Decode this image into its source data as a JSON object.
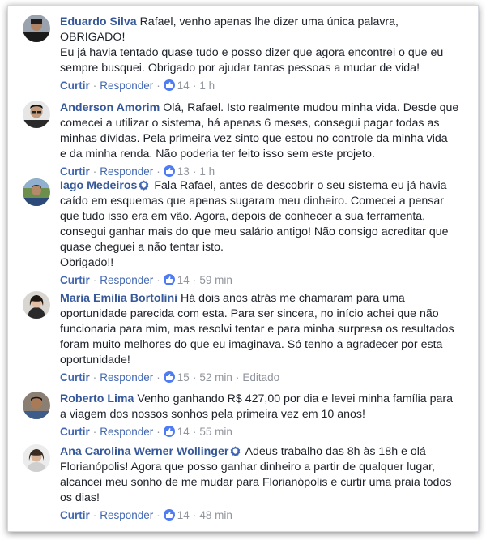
{
  "actions": {
    "curtir": "Curtir",
    "responder": "Responder",
    "dot": "·"
  },
  "colors": {
    "name": "#365899",
    "link": "#4267b2",
    "meta": "#90949c",
    "like": "#4f7cf3"
  },
  "comments": [
    {
      "name": "Eduardo Silva",
      "verified": false,
      "lines": [
        "Rafael, venho apenas lhe dizer uma única palavra,",
        "OBRIGADO!",
        "Eu já havia tentado quase tudo e posso dizer que agora encontrei o que eu",
        "sempre busquei. Obrigado por ajudar tantas pessoas a mudar de vida!"
      ],
      "likes": "14",
      "time": "1 h",
      "edited": ""
    },
    {
      "name": "Anderson Amorim",
      "verified": false,
      "lines": [
        "Olá, Rafael. Isto realmente mudou minha vida. Desde que",
        "comecei a utilizar o sistema, há apenas 6 meses, consegui pagar todas as",
        "minhas dívidas. Pela primeira vez sinto que estou no controle da minha vida",
        "e da minha renda. Não poderia ter feito isso sem este projeto."
      ],
      "likes": "13",
      "time": "1 h",
      "edited": ""
    },
    {
      "name": "Iago Medeiros",
      "verified": true,
      "lines": [
        "Fala Rafael, antes de descobrir o seu sistema eu já havia",
        "caído em esquemas que apenas sugaram meu dinheiro. Comecei a pensar",
        "que tudo isso era em vão. Agora, depois de conhecer a sua ferramenta,",
        "consegui ganhar mais do que meu salário antigo! Não consigo acreditar que",
        "quase cheguei a não tentar isto.",
        "Obrigado!!"
      ],
      "likes": "14",
      "time": "59 min",
      "edited": ""
    },
    {
      "name": "Maria Emilia Bortolini",
      "verified": false,
      "lines": [
        "Há dois anos atrás me chamaram para uma",
        "oportunidade parecida com esta. Para ser sincera, no início achei que não",
        "funcionaria para mim, mas resolvi tentar e para minha surpresa os resultados",
        "foram muito melhores do que eu imaginava. Só tenho a agradecer por esta",
        "oportunidade!"
      ],
      "likes": "15",
      "time": "52 min",
      "edited": "Editado"
    },
    {
      "name": "Roberto Lima",
      "verified": false,
      "lines": [
        "Venho ganhando R$ 427,00 por dia e levei minha família para",
        "a viagem dos nossos sonhos pela primeira vez em 10 anos!"
      ],
      "likes": "14",
      "time": "55 min",
      "edited": ""
    },
    {
      "name": "Ana Carolina Werner Wollinger",
      "verified": true,
      "lines": [
        "Adeus trabalho das 8h às 18h e olá",
        "Florianópolis! Agora que posso ganhar dinheiro a partir de qualquer lugar,",
        "alcancei meu sonho de me mudar para Florianópolis e curtir uma praia todos",
        "os dias!"
      ],
      "likes": "14",
      "time": "48 min",
      "edited": ""
    }
  ]
}
